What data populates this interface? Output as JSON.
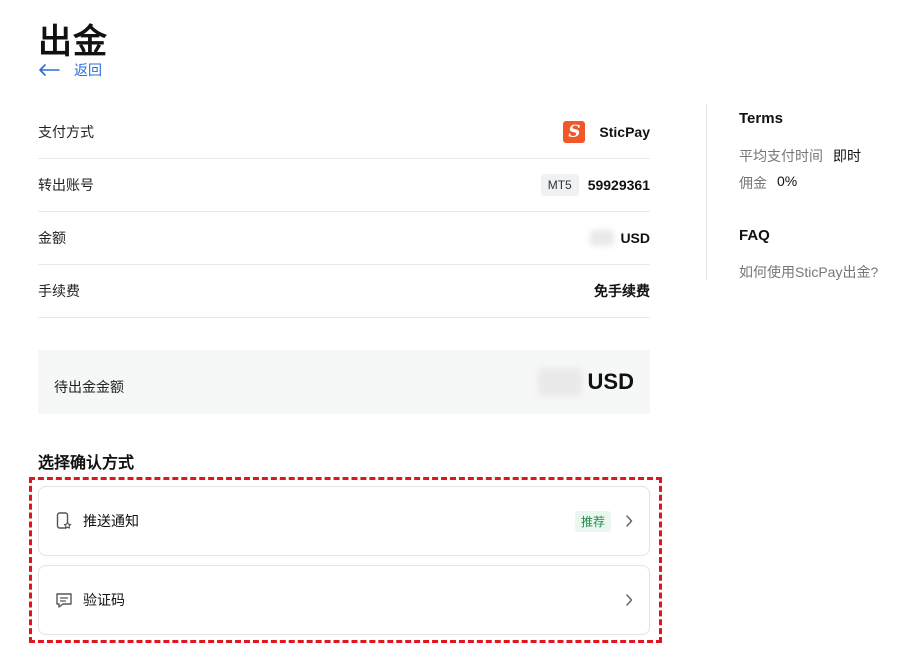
{
  "header": {
    "title": "出金",
    "back_label": "返回"
  },
  "details": {
    "rows": [
      {
        "label": "支付方式",
        "value": "SticPay",
        "logo_letter": "S"
      },
      {
        "label": "转出账号",
        "badge": "MT5",
        "value": "59929361"
      },
      {
        "label": "金额",
        "value": "USD"
      },
      {
        "label": "手续费",
        "value": "免手续费"
      }
    ]
  },
  "pending": {
    "label": "待出金金额",
    "currency": "USD"
  },
  "confirm": {
    "title": "选择确认方式",
    "options": [
      {
        "label": "推送通知",
        "badge": "推荐",
        "icon": "phone-star-icon"
      },
      {
        "label": "验证码",
        "icon": "message-icon"
      }
    ]
  },
  "sidebar": {
    "terms_title": "Terms",
    "terms": [
      {
        "key": "平均支付时间",
        "value": "即时"
      },
      {
        "key": "佣金",
        "value": "0%"
      }
    ],
    "faq_title": "FAQ",
    "faq_link": "如何使用SticPay出金?"
  },
  "colors": {
    "accent": "#2a6fd8",
    "sticpay": "#f0582a",
    "highlight": "#e0151d",
    "recommend_bg": "#e9f7ee",
    "recommend_text": "#1f8a4c"
  }
}
